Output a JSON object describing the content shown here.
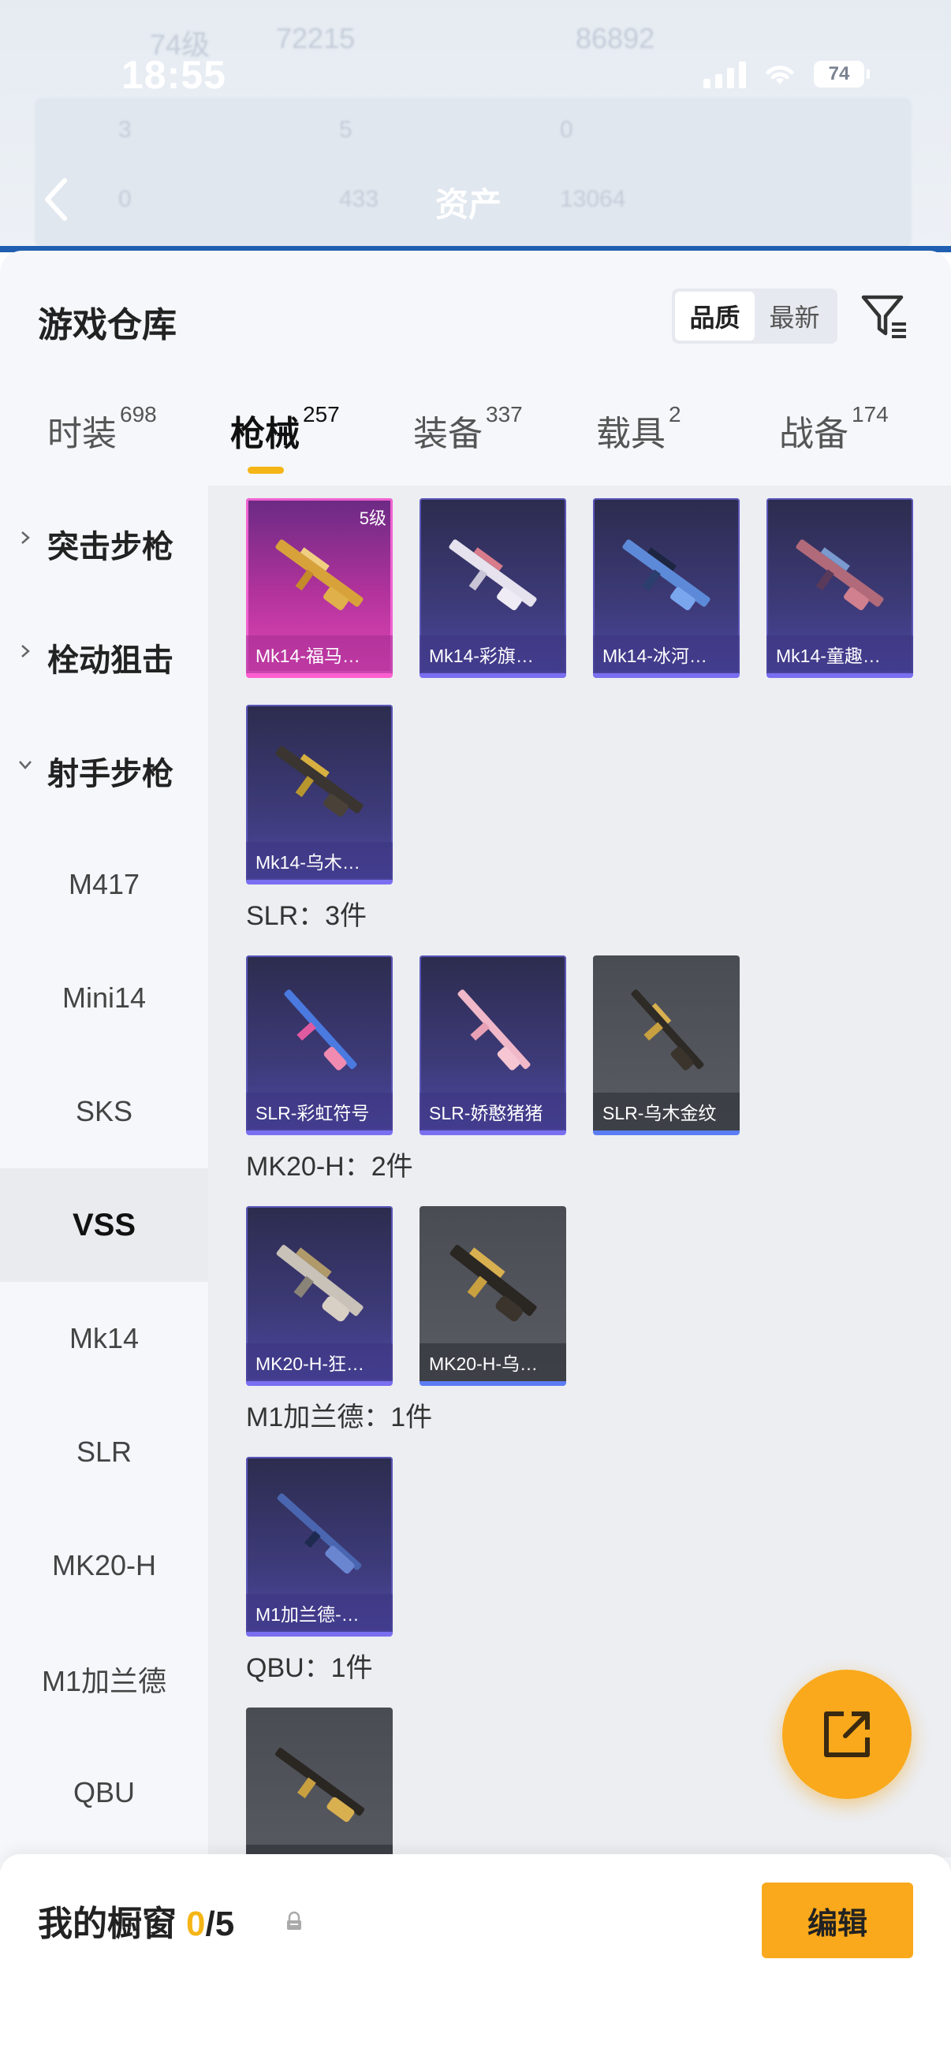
{
  "status_bar": {
    "time": "18:55",
    "battery": "74"
  },
  "nav": {
    "title": "资产"
  },
  "background_ghost": {
    "level": "74级",
    "coins": "72215",
    "other": "86892",
    "stat1": "3",
    "stat2": "5",
    "stat3": "0",
    "stat4": "0",
    "stat5": "433",
    "stat6": "13064"
  },
  "warehouse": {
    "title": "游戏仓库",
    "sort_options": [
      "品质",
      "最新"
    ],
    "sort_selected": "品质"
  },
  "tabs": [
    {
      "label": "时装",
      "count": "698"
    },
    {
      "label": "枪械",
      "count": "257",
      "active": true
    },
    {
      "label": "装备",
      "count": "337"
    },
    {
      "label": "载具",
      "count": "2"
    },
    {
      "label": "战备",
      "count": "174"
    }
  ],
  "sidebar": {
    "categories": [
      {
        "label": "突击步枪",
        "expanded": false
      },
      {
        "label": "栓动狙击",
        "expanded": false
      },
      {
        "label": "射手步枪",
        "expanded": true
      }
    ],
    "subcategories": [
      "M417",
      "Mini14",
      "SKS",
      "VSS",
      "Mk14",
      "SLR",
      "MK20-H",
      "M1加兰德",
      "QBU"
    ],
    "active_sub": "VSS"
  },
  "groups": [
    {
      "title": "",
      "items": [
        {
          "name": "Mk14-福马…",
          "rarity": "legendary",
          "level": "5级"
        },
        {
          "name": "Mk14-彩旗…",
          "rarity": "epic"
        },
        {
          "name": "Mk14-冰河…",
          "rarity": "epic"
        },
        {
          "name": "Mk14-童趣…",
          "rarity": "epic"
        },
        {
          "name": "Mk14-乌木…",
          "rarity": "epic"
        }
      ]
    },
    {
      "title": "SLR：3件",
      "items": [
        {
          "name": "SLR-彩虹符号",
          "rarity": "epic"
        },
        {
          "name": "SLR-娇憨猪猪",
          "rarity": "epic"
        },
        {
          "name": "SLR-乌木金纹",
          "rarity": "rare"
        }
      ]
    },
    {
      "title": "MK20-H：2件",
      "items": [
        {
          "name": "MK20-H-狂…",
          "rarity": "epic"
        },
        {
          "name": "MK20-H-乌…",
          "rarity": "rare"
        }
      ]
    },
    {
      "title": "M1加兰德：1件",
      "items": [
        {
          "name": "M1加兰德-…",
          "rarity": "epic"
        }
      ]
    },
    {
      "title": "QBU：1件",
      "items": [
        {
          "name": "",
          "rarity": "rare"
        }
      ]
    }
  ],
  "showcase": {
    "title": "我的橱窗",
    "used": "0",
    "sep": "/",
    "total": "5",
    "edit_label": "编辑"
  },
  "colors": {
    "accent": "#f5b516",
    "fab": "#f9a91b",
    "epic": "#3d3a78",
    "legendary": "#e247b6",
    "rare": "#5a5c64"
  },
  "icons": [
    "back-icon",
    "filter-icon",
    "chevron-right-icon",
    "chevron-down-icon",
    "share-icon",
    "lock-icon",
    "rifle-icon"
  ]
}
